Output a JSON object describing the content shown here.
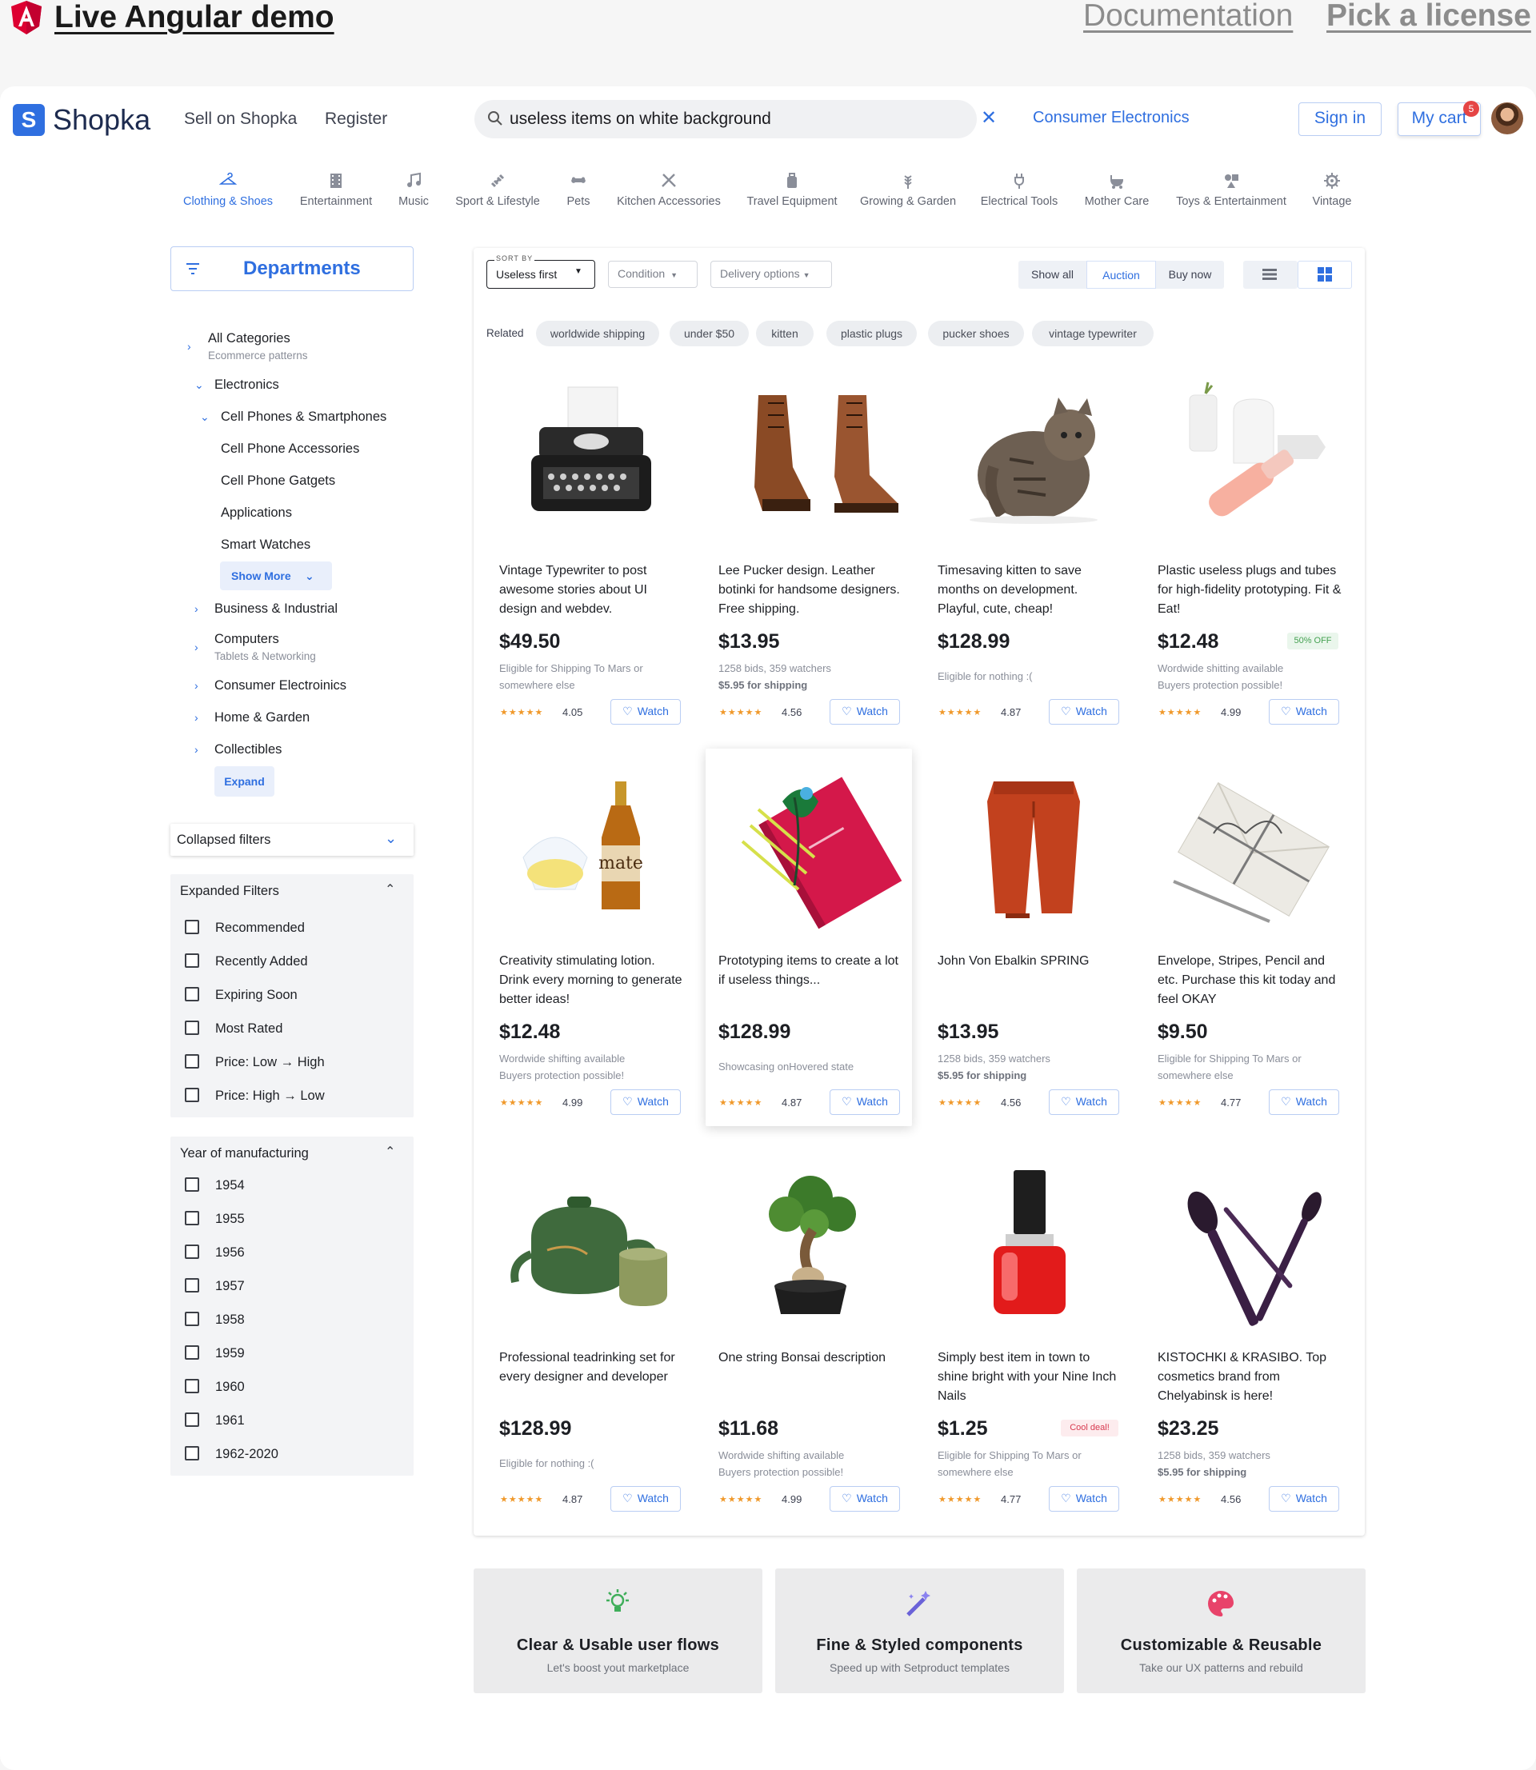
{
  "topbar": {
    "demo_title": "Live Angular demo",
    "documentation": "Documentation",
    "license": "Pick a license"
  },
  "header": {
    "logo_letter": "S",
    "logo_text": "Shopka",
    "nav": [
      "Sell on Shopka",
      "Register"
    ],
    "search_value": "useless items on white background",
    "category_link": "Consumer Electronics",
    "sign_in": "Sign in",
    "cart": "My cart",
    "cart_count": "5"
  },
  "categories": [
    {
      "label": "Clothing & Shoes",
      "icon": "hanger-icon",
      "active": true
    },
    {
      "label": "Entertainment",
      "icon": "film-icon"
    },
    {
      "label": "Music",
      "icon": "music-note-icon"
    },
    {
      "label": "Sport & Lifestyle",
      "icon": "dumbbell-icon"
    },
    {
      "label": "Pets",
      "icon": "bone-icon"
    },
    {
      "label": "Kitchen Accessories",
      "icon": "utensils-icon"
    },
    {
      "label": "Travel Equipment",
      "icon": "luggage-icon"
    },
    {
      "label": "Growing & Garden",
      "icon": "wheat-icon"
    },
    {
      "label": "Electrical Tools",
      "icon": "plug-icon"
    },
    {
      "label": "Mother Care",
      "icon": "stroller-icon"
    },
    {
      "label": "Toys & Entertainment",
      "icon": "toys-icon"
    },
    {
      "label": "Vintage",
      "icon": "gear-icon"
    }
  ],
  "sidebar": {
    "departments": "Departments",
    "all_categories": "All Categories",
    "all_categories_sub": "Ecommerce patterns",
    "electronics": "Electronics",
    "cell_phones": "Cell Phones & Smartphones",
    "cell_children": [
      "Cell Phone Accessories",
      "Cell Phone Gatgets",
      "Applications",
      "Smart Watches"
    ],
    "show_more": "Show More",
    "business": "Business & Industrial",
    "computers": "Computers",
    "computers_sub": "Tablets & Networking",
    "consumer": "Consumer Electroinics",
    "home_garden": "Home & Garden",
    "collectibles": "Collectibles",
    "expand": "Expand",
    "collapsed_filters": "Collapsed filters",
    "expanded_filters": "Expanded Filters",
    "filters": [
      "Recommended",
      "Recently Added",
      "Expiring Soon",
      "Most Rated",
      "Price: Low → High",
      "Price: High → Low"
    ],
    "year_title": "Year of manufacturing",
    "years": [
      "1954",
      "1955",
      "1956",
      "1957",
      "1958",
      "1959",
      "1960",
      "1961",
      "1962-2020"
    ]
  },
  "toolbar": {
    "sort_caption": "SORT BY",
    "sort_value": "Useless first",
    "condition": "Condition",
    "delivery": "Delivery options",
    "seg": [
      "Show all",
      "Auction",
      "Buy now"
    ]
  },
  "related": {
    "label": "Related",
    "chips": [
      "worldwide shipping",
      "under $50",
      "kitten",
      "plastic plugs",
      "pucker shoes",
      "vintage typewriter"
    ]
  },
  "products": [
    {
      "title": "Vintage Typewriter to post awesome stories about UI design and webdev.",
      "price": "$49.50",
      "note1": "Eligible for Shipping To Mars or",
      "note2": "somewhere else",
      "rating": "4.05",
      "img": "typewriter"
    },
    {
      "title": "Lee Pucker design. Leather botinki for handsome designers. Free shipping.",
      "price": "$13.95",
      "note1": "1258 bids, 359 watchers",
      "note2": "$5.95 for shipping",
      "rating": "4.56",
      "img": "boots"
    },
    {
      "title": "Timesaving kitten to save months on development. Playful, cute, cheap!",
      "price": "$128.99",
      "note1": "Eligible for nothing :(",
      "note2": "",
      "rating": "4.87",
      "img": "cat"
    },
    {
      "title": "Plastic useless plugs and tubes for high-fidelity prototyping. Fit & Eat!",
      "price": "$12.48",
      "badge": "50% OFF",
      "note1": "Wordwide shitting available",
      "note2": "Buyers protection possible!",
      "rating": "4.99",
      "img": "plugs"
    },
    {
      "title": "Creativity stimulating lotion. Drink every morning to generate better ideas!",
      "price": "$12.48",
      "note1": "Wordwide shifting available",
      "note2": "Buyers protection possible!",
      "rating": "4.99",
      "img": "mate"
    },
    {
      "title": "Prototyping items to create a lot if useless things...",
      "price": "$128.99",
      "note1": "Showcasing onHovered state",
      "note2": "",
      "rating": "4.87",
      "img": "notebook"
    },
    {
      "title": "John Von Ebalkin SPRING",
      "price": "$13.95",
      "note1": "1258 bids, 359 watchers",
      "note2": "$5.95 for shipping",
      "rating": "4.56",
      "img": "pants"
    },
    {
      "title": "Envelope, Stripes, Pencil and etc. Purchase this kit today and feel OKAY",
      "price": "$9.50",
      "note1": "Eligible for Shipping To Mars or",
      "note2": "somewhere else",
      "rating": "4.77",
      "img": "envelope"
    },
    {
      "title": "Professional teadrinking set for every designer and developer",
      "price": "$128.99",
      "note1": "Eligible for nothing :(",
      "note2": "",
      "rating": "4.87",
      "img": "teapot"
    },
    {
      "title": "One string Bonsai description",
      "price": "$11.68",
      "note1": "Wordwide shifting available",
      "note2": "Buyers protection possible!",
      "rating": "4.99",
      "img": "bonsai"
    },
    {
      "title": "Simply best item in town to shine bright with your Nine Inch Nails",
      "price": "$1.25",
      "badge": "Cool deal!",
      "note1": "Eligible for Shipping To Mars or",
      "note2": "somewhere else",
      "rating": "4.77",
      "img": "polish"
    },
    {
      "title": "KISTOCHKI & KRASIBO. Top cosmetics brand from Chelyabinsk is here!",
      "price": "$23.25",
      "note1": "1258 bids, 359 watchers",
      "note2": "$5.95 for shipping",
      "rating": "4.56",
      "img": "brushes"
    }
  ],
  "watch_label": "Watch",
  "features": [
    {
      "title": "Clear & Usable user flows",
      "sub": "Let's boost yout marketplace",
      "icon": "lightbulb-icon"
    },
    {
      "title": "Fine & Styled components",
      "sub": "Speed up with Setproduct templates",
      "icon": "magic-wand-icon"
    },
    {
      "title": "Customizable & Reusable",
      "sub": "Take our UX patterns and rebuild",
      "icon": "palette-icon"
    }
  ],
  "colors": {
    "accent": "#2f6fe0",
    "badge_red": "#e54545",
    "angular_red": "#dd0031"
  }
}
